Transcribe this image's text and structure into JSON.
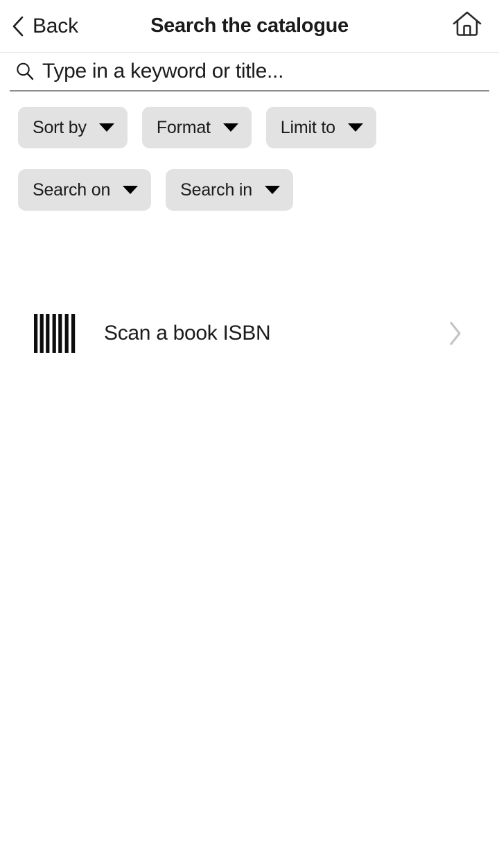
{
  "header": {
    "back_label": "Back",
    "title": "Search the catalogue",
    "back_icon": "chevron-left-icon",
    "home_icon": "home-icon"
  },
  "search": {
    "placeholder": "Type in a keyword or title...",
    "value": "",
    "icon": "search-icon"
  },
  "filters": {
    "rows": [
      [
        {
          "label": "Sort by",
          "icon": "caret-down-icon"
        },
        {
          "label": "Format",
          "icon": "caret-down-icon"
        },
        {
          "label": "Limit to",
          "icon": "caret-down-icon"
        }
      ],
      [
        {
          "label": "Search on",
          "icon": "caret-down-icon"
        },
        {
          "label": "Search in",
          "icon": "caret-down-icon"
        }
      ]
    ]
  },
  "scan": {
    "label": "Scan a book ISBN",
    "icon": "barcode-icon",
    "chevron": "chevron-right-icon"
  },
  "colors": {
    "background": "#ffffff",
    "text": "#1b1b1b",
    "chip_background": "#e2e2e2",
    "divider": "#e6e6e6",
    "input_underline": "#8d8d8d",
    "chevron_right": "#c4c4c4"
  }
}
